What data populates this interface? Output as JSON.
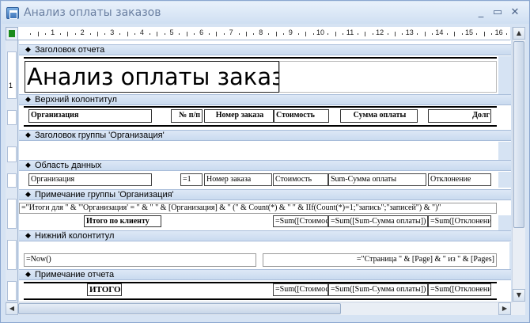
{
  "window": {
    "title": "Анализ оплаты заказов",
    "buttons": {
      "minimize": "_",
      "restore": "▭",
      "close": "✕"
    }
  },
  "ruler": {
    "numbers": [
      "1",
      "2",
      "3",
      "4",
      "5",
      "6",
      "7",
      "8",
      "9",
      "10",
      "11",
      "12",
      "13",
      "14",
      "15",
      "16"
    ]
  },
  "vruler_numbers": [
    "1"
  ],
  "sections": {
    "report_header": "Заголовок отчета",
    "page_header": "Верхний колонтитул",
    "group_header": "Заголовок группы 'Организация'",
    "detail": "Область данных",
    "group_footer": "Примечание группы 'Организация'",
    "page_footer": "Нижний колонтитул",
    "report_footer": "Примечание отчета"
  },
  "report_title": "Анализ оплаты заказов",
  "page_header_labels": {
    "org": "Организация",
    "num": "№ п/п",
    "order": "Номер заказа",
    "cost": "Стоимость",
    "paid": "Сумма оплаты",
    "debt": "Долг"
  },
  "detail_fields": {
    "org": "Организация",
    "num": "=1",
    "order": "Номер заказа",
    "cost": "Стоимость",
    "paid": "Sum-Сумма оплаты",
    "dev": "Отклонение"
  },
  "group_footer": {
    "expr": "=\"Итоги для \" & \"'Организация' = \" & \" \" & [Организация] & \" (\" & Count(*) & \" \" & IIf(Count(*)=1;\"запись\";\"записей\") & \")\"",
    "client_total": "Итого по клиенту",
    "sum_cost": "=Sum([Стоимость])",
    "sum_paid": "=Sum([Sum-Сумма оплаты])",
    "sum_dev": "=Sum([Отклонение])"
  },
  "page_footer": {
    "now": "=Now()",
    "pages": "=\"Страница \" & [Page] & \" из \" & [Pages]"
  },
  "report_footer": {
    "total": "ИТОГО",
    "sum_cost": "=Sum([Стоимость])",
    "sum_paid": "=Sum([Sum-Сумма оплаты])",
    "sum_dev": "=Sum([Отклонение])"
  },
  "colors": {
    "window_frame": "#d6e3f3",
    "band": "#c9daef",
    "corner_marker": "#1b8b1b"
  }
}
